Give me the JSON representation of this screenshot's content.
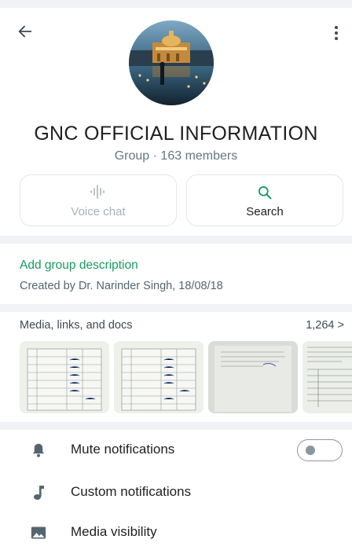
{
  "header": {
    "back_icon": "arrow-left-icon",
    "more_icon": "more-vertical-icon"
  },
  "profile": {
    "name": "GNC OFFICIAL INFORMATION",
    "meta": "Group · 163 members"
  },
  "actions": [
    {
      "label": "Voice chat",
      "icon": "waveform-icon",
      "enabled": false
    },
    {
      "label": "Search",
      "icon": "search-icon",
      "enabled": true
    }
  ],
  "description": {
    "add_label": "Add group description",
    "created_by": "Created by Dr. Narinder Singh, 18/08/18"
  },
  "media": {
    "title": "Media, links, and docs",
    "count": "1,264 >"
  },
  "settings": [
    {
      "label": "Mute notifications",
      "icon": "bell-icon",
      "toggle": false
    },
    {
      "label": "Custom notifications",
      "icon": "music-note-icon"
    },
    {
      "label": "Media visibility",
      "icon": "image-icon"
    }
  ],
  "colors": {
    "accent": "#1a9a62",
    "muted_text": "#667781",
    "icon": "#54656f"
  }
}
